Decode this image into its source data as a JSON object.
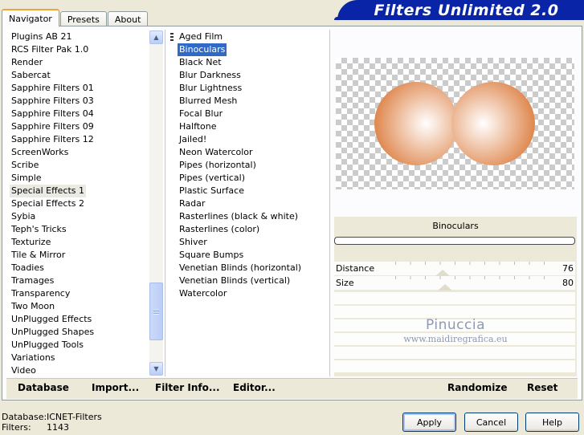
{
  "tabs": [
    "Navigator",
    "Presets",
    "About"
  ],
  "title": "Filters Unlimited 2.0",
  "categories": [
    "Plugins AB 21",
    "RCS Filter Pak 1.0",
    "Render",
    "Sabercat",
    "Sapphire Filters 01",
    "Sapphire Filters 03",
    "Sapphire Filters 04",
    "Sapphire Filters 09",
    "Sapphire Filters 12",
    "ScreenWorks",
    "Scribe",
    "Simple",
    "Special Effects 1",
    "Special Effects 2",
    "Sybia",
    "Teph's Tricks",
    "Texturize",
    "Tile & Mirror",
    "Toadies",
    "Tramages",
    "Transparency",
    "Two Moon",
    "UnPlugged Effects",
    "UnPlugged Shapes",
    "UnPlugged Tools",
    "Variations",
    "Video"
  ],
  "selected_category": "Special Effects 1",
  "filters": [
    "Aged Film",
    "Binoculars",
    "Black Net",
    "Blur Darkness",
    "Blur Lightness",
    "Blurred Mesh",
    "Focal Blur",
    "Halftone",
    "Jailed!",
    "Neon Watercolor",
    "Pipes (horizontal)",
    "Pipes (vertical)",
    "Plastic Surface",
    "Radar",
    "Rasterlines (black & white)",
    "Rasterlines (color)",
    "Shiver",
    "Square Bumps",
    "Venetian Blinds (horizontal)",
    "Venetian Blinds (vertical)",
    "Watercolor"
  ],
  "selected_filter": "Binoculars",
  "preview": {
    "shape_color": "#e08a52",
    "highlight_color": "#ffffff"
  },
  "filter_name": "Binoculars",
  "params": [
    {
      "label": "Distance",
      "value": "76",
      "level": 76
    },
    {
      "label": "Size",
      "value": "80",
      "level": 80
    }
  ],
  "watermark": {
    "name": "Pinuccia",
    "url": "www.maidiregrafica.eu"
  },
  "links": {
    "database": "Database",
    "import": "Import...",
    "filter_info": "Filter Info...",
    "editor": "Editor...",
    "randomize": "Randomize",
    "reset": "Reset"
  },
  "info": {
    "database_label": "Database:",
    "database_value": "ICNET-Filters",
    "filters_label": "Filters:",
    "filters_value": "1143"
  },
  "buttons": {
    "apply": "Apply",
    "cancel": "Cancel",
    "help": "Help"
  },
  "colors": {
    "selection": "#316ac5",
    "banner": "#0a24a8",
    "window": "#ece9d8"
  }
}
